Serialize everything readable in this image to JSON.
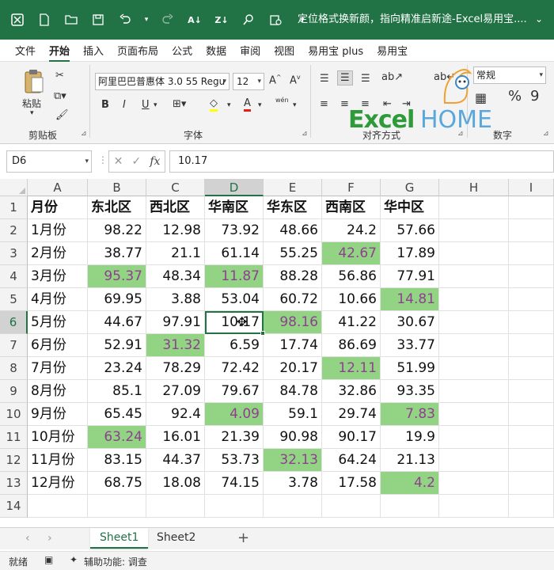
{
  "titlebar": {
    "title": "定位格式换新颜，指向精准启新途-Excel易用宝....",
    "icons": [
      "excel-app-icon",
      "new-file-icon",
      "open-folder-icon",
      "save-icon",
      "undo-icon",
      "redo-icon",
      "sort-ascending-icon",
      "sort-descending-icon",
      "find-icon",
      "accessibility-icon"
    ]
  },
  "menu": [
    "文件",
    "开始",
    "插入",
    "页面布局",
    "公式",
    "数据",
    "审阅",
    "视图",
    "易用宝 plus",
    "易用宝"
  ],
  "ribbon": {
    "paste_label": "粘贴",
    "clipboard_label": "剪贴板",
    "font_label": "字体",
    "align_label": "对齐方式",
    "number_label": "数字",
    "font_name": "阿里巴巴普惠体 3.0 55 Regu",
    "font_size": "12",
    "number_format": "常规",
    "bold": "B",
    "italic": "I",
    "underline": "U",
    "percent": "%",
    "comma": "9",
    "phonetic": "wén",
    "logo_excel": "Excel",
    "logo_home": "HOME"
  },
  "formula": {
    "name_box": "D6",
    "fx": "fx",
    "value": "10.17"
  },
  "grid": {
    "columns": [
      "A",
      "B",
      "C",
      "D",
      "E",
      "F",
      "G",
      "H",
      "I"
    ],
    "rows": [
      "1",
      "2",
      "3",
      "4",
      "5",
      "6",
      "7",
      "8",
      "9",
      "10",
      "11",
      "12",
      "13",
      "14"
    ],
    "headers": [
      "月份",
      "东北区",
      "西北区",
      "华南区",
      "华东区",
      "西南区",
      "华中区"
    ],
    "data": [
      [
        "1月份",
        "98.22",
        "12.98",
        "73.92",
        "48.66",
        "24.2",
        "57.66"
      ],
      [
        "2月份",
        "38.77",
        "21.1",
        "61.14",
        "55.25",
        "42.67",
        "17.89"
      ],
      [
        "3月份",
        "95.37",
        "48.34",
        "11.87",
        "88.28",
        "56.86",
        "77.91"
      ],
      [
        "4月份",
        "69.95",
        "3.88",
        "53.04",
        "60.72",
        "10.66",
        "14.81"
      ],
      [
        "5月份",
        "44.67",
        "97.91",
        "10.17",
        "98.16",
        "41.22",
        "30.67"
      ],
      [
        "6月份",
        "52.91",
        "31.32",
        "6.59",
        "17.74",
        "86.69",
        "33.77"
      ],
      [
        "7月份",
        "23.24",
        "78.29",
        "72.42",
        "20.17",
        "12.11",
        "51.99"
      ],
      [
        "8月份",
        "85.1",
        "27.09",
        "79.67",
        "84.78",
        "32.86",
        "93.35"
      ],
      [
        "9月份",
        "65.45",
        "92.4",
        "4.09",
        "59.1",
        "29.74",
        "7.83"
      ],
      [
        "10月份",
        "63.24",
        "16.01",
        "21.39",
        "90.98",
        "90.17",
        "19.9"
      ],
      [
        "11月份",
        "83.15",
        "44.37",
        "53.73",
        "32.13",
        "64.24",
        "21.13"
      ],
      [
        "12月份",
        "68.75",
        "18.08",
        "74.15",
        "3.78",
        "17.58",
        "4.2"
      ]
    ],
    "highlight_color": "#92d483",
    "highlight_text_color": "#8f3f8f",
    "highlighted": [
      [
        2,
        5
      ],
      [
        3,
        1
      ],
      [
        3,
        3
      ],
      [
        4,
        6
      ],
      [
        5,
        4
      ],
      [
        6,
        2
      ],
      [
        7,
        5
      ],
      [
        9,
        3
      ],
      [
        9,
        6
      ],
      [
        10,
        1
      ],
      [
        11,
        4
      ],
      [
        12,
        6
      ]
    ],
    "active_cell": "D6"
  },
  "sheets": {
    "tabs": [
      "Sheet1",
      "Sheet2"
    ],
    "active": "Sheet1",
    "add": "+"
  },
  "status": {
    "ready": "就绪",
    "accessibility": "辅助功能: 调查"
  },
  "colors": {
    "accent": "#217346",
    "highlight": "#92d483"
  }
}
